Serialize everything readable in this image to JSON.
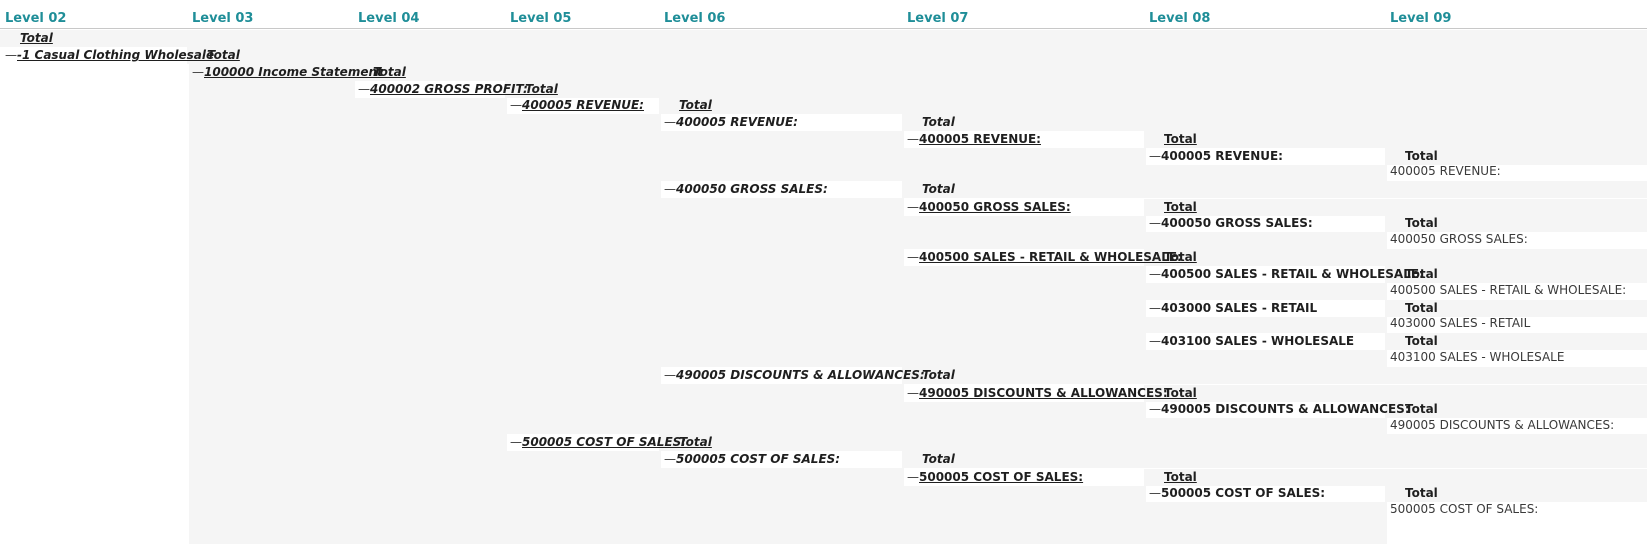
{
  "headers": [
    "Level 02",
    "Level 03",
    "Level 04",
    "Level 05",
    "Level 06",
    "Level 07",
    "Level 08",
    "Level 09"
  ],
  "toggle": "—",
  "rows": [
    {
      "cells": [
        {
          "col": 0,
          "text": "Total",
          "kind": "bi-u",
          "toggle": false
        }
      ]
    },
    {
      "cells": [
        {
          "col": 0,
          "text": "-1 Casual Clothing Wholesale",
          "kind": "bi-u",
          "toggle": true
        },
        {
          "col": 1,
          "text": "Total",
          "kind": "bi-u",
          "toggle": false
        }
      ]
    },
    {
      "cells": [
        {
          "col": 1,
          "text": "100000 Income Statement",
          "kind": "bi-u",
          "toggle": true
        },
        {
          "col": 2,
          "text": "Total",
          "kind": "bi-u",
          "toggle": false
        }
      ]
    },
    {
      "cells": [
        {
          "col": 2,
          "text": "400002 GROSS PROFIT:",
          "kind": "bi-u",
          "toggle": true
        },
        {
          "col": 3,
          "text": "Total",
          "kind": "bi-u",
          "toggle": false
        }
      ]
    },
    {
      "cells": [
        {
          "col": 3,
          "text": "400005 REVENUE:",
          "kind": "bi-u",
          "toggle": true
        },
        {
          "col": 4,
          "text": "Total",
          "kind": "bi-u",
          "toggle": false
        }
      ]
    },
    {
      "cells": [
        {
          "col": 4,
          "text": "400005 REVENUE:",
          "kind": "bi",
          "toggle": true
        },
        {
          "col": 5,
          "text": "Total",
          "kind": "bi",
          "toggle": false
        }
      ]
    },
    {
      "cells": [
        {
          "col": 5,
          "text": "400005 REVENUE:",
          "kind": "b-u",
          "toggle": true
        },
        {
          "col": 6,
          "text": "Total",
          "kind": "b-u",
          "toggle": false
        }
      ]
    },
    {
      "cells": [
        {
          "col": 6,
          "text": "400005 REVENUE:",
          "kind": "b",
          "toggle": true
        },
        {
          "col": 7,
          "text": "Total",
          "kind": "b",
          "toggle": false
        }
      ]
    },
    {
      "cells": [
        {
          "col": 7,
          "text": "400005 REVENUE:",
          "kind": "leaf",
          "toggle": false
        }
      ]
    },
    {
      "cells": [
        {
          "col": 4,
          "text": "400050 GROSS SALES:",
          "kind": "bi",
          "toggle": true
        },
        {
          "col": 5,
          "text": "Total",
          "kind": "bi",
          "toggle": false
        }
      ]
    },
    {
      "cells": [
        {
          "col": 5,
          "text": "400050 GROSS SALES:",
          "kind": "b-u",
          "toggle": true
        },
        {
          "col": 6,
          "text": "Total",
          "kind": "b-u",
          "toggle": false
        }
      ]
    },
    {
      "cells": [
        {
          "col": 6,
          "text": "400050 GROSS SALES:",
          "kind": "b",
          "toggle": true
        },
        {
          "col": 7,
          "text": "Total",
          "kind": "b",
          "toggle": false
        }
      ]
    },
    {
      "cells": [
        {
          "col": 7,
          "text": "400050 GROSS SALES:",
          "kind": "leaf",
          "toggle": false
        }
      ]
    },
    {
      "cells": [
        {
          "col": 5,
          "text": "400500 SALES - RETAIL & WHOLESALE:",
          "kind": "b-u",
          "toggle": true
        },
        {
          "col": 6,
          "text": "Total",
          "kind": "b-u",
          "toggle": false
        }
      ]
    },
    {
      "cells": [
        {
          "col": 6,
          "text": "400500 SALES - RETAIL & WHOLESALE:",
          "kind": "b",
          "toggle": true
        },
        {
          "col": 7,
          "text": "Total",
          "kind": "b",
          "toggle": false
        }
      ]
    },
    {
      "cells": [
        {
          "col": 7,
          "text": "400500 SALES - RETAIL & WHOLESALE:",
          "kind": "leaf",
          "toggle": false
        }
      ]
    },
    {
      "cells": [
        {
          "col": 6,
          "text": "403000 SALES - RETAIL",
          "kind": "b",
          "toggle": true
        },
        {
          "col": 7,
          "text": "Total",
          "kind": "b",
          "toggle": false
        }
      ]
    },
    {
      "cells": [
        {
          "col": 7,
          "text": "403000 SALES - RETAIL",
          "kind": "leaf",
          "toggle": false
        }
      ]
    },
    {
      "cells": [
        {
          "col": 6,
          "text": "403100 SALES - WHOLESALE",
          "kind": "b",
          "toggle": true
        },
        {
          "col": 7,
          "text": "Total",
          "kind": "b",
          "toggle": false
        }
      ]
    },
    {
      "cells": [
        {
          "col": 7,
          "text": "403100 SALES - WHOLESALE",
          "kind": "leaf",
          "toggle": false
        }
      ]
    },
    {
      "cells": [
        {
          "col": 4,
          "text": "490005 DISCOUNTS & ALLOWANCES:",
          "kind": "bi",
          "toggle": true
        },
        {
          "col": 5,
          "text": "Total",
          "kind": "bi",
          "toggle": false
        }
      ]
    },
    {
      "cells": [
        {
          "col": 5,
          "text": "490005 DISCOUNTS & ALLOWANCES:",
          "kind": "b-u",
          "toggle": true
        },
        {
          "col": 6,
          "text": "Total",
          "kind": "b-u",
          "toggle": false
        }
      ]
    },
    {
      "cells": [
        {
          "col": 6,
          "text": "490005 DISCOUNTS & ALLOWANCES:",
          "kind": "b",
          "toggle": true
        },
        {
          "col": 7,
          "text": "Total",
          "kind": "b",
          "toggle": false
        }
      ]
    },
    {
      "cells": [
        {
          "col": 7,
          "text": "490005 DISCOUNTS & ALLOWANCES:",
          "kind": "leaf",
          "toggle": false
        }
      ]
    },
    {
      "cells": [
        {
          "col": 3,
          "text": "500005 COST OF SALES:",
          "kind": "bi-u",
          "toggle": true
        },
        {
          "col": 4,
          "text": "Total",
          "kind": "bi-u",
          "toggle": false
        }
      ]
    },
    {
      "cells": [
        {
          "col": 4,
          "text": "500005 COST OF SALES:",
          "kind": "bi",
          "toggle": true
        },
        {
          "col": 5,
          "text": "Total",
          "kind": "bi",
          "toggle": false
        }
      ]
    },
    {
      "cells": [
        {
          "col": 5,
          "text": "500005 COST OF SALES:",
          "kind": "b-u",
          "toggle": true
        },
        {
          "col": 6,
          "text": "Total",
          "kind": "b-u",
          "toggle": false
        }
      ]
    },
    {
      "cells": [
        {
          "col": 6,
          "text": "500005 COST OF SALES:",
          "kind": "b",
          "toggle": true
        },
        {
          "col": 7,
          "text": "Total",
          "kind": "b",
          "toggle": false
        }
      ]
    },
    {
      "cells": [
        {
          "col": 7,
          "text": "500005 COST OF SALES:",
          "kind": "leaf",
          "toggle": false
        }
      ]
    }
  ]
}
